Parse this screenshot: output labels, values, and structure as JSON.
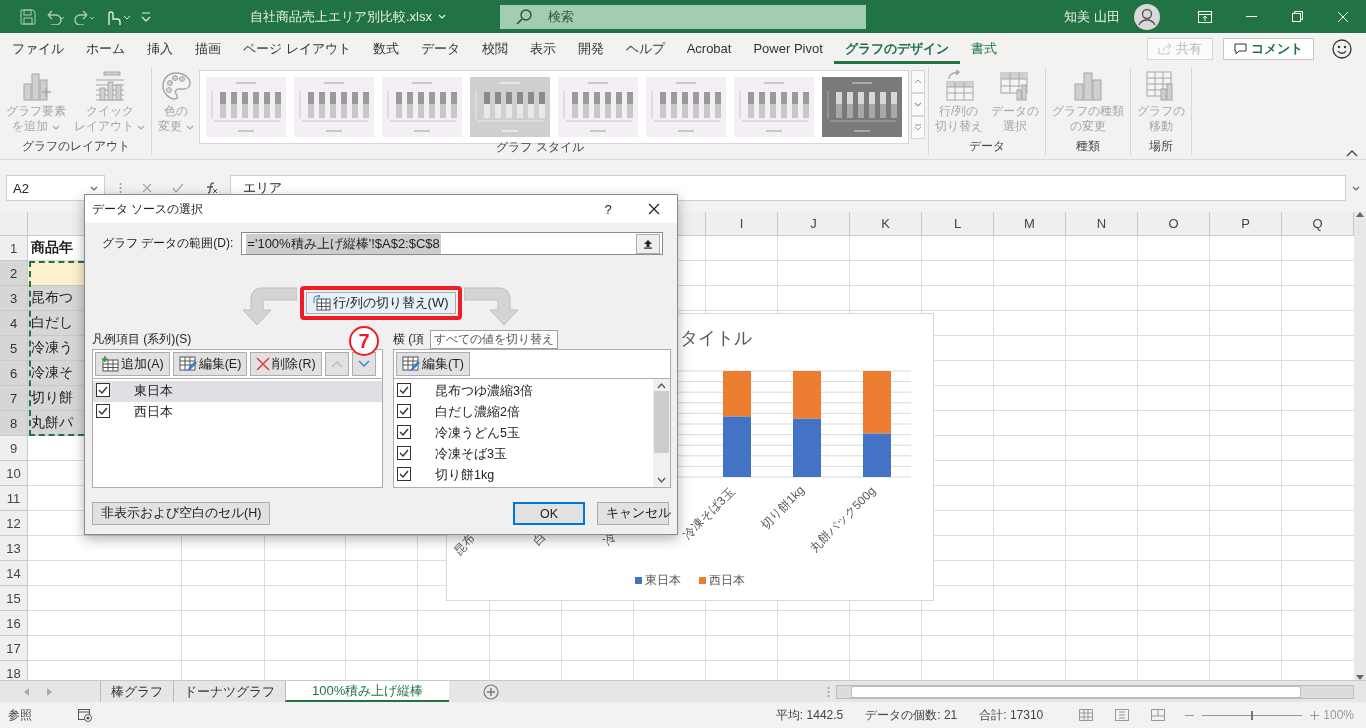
{
  "title_bar": {
    "file_name": "自社商品売上エリア別比較.xlsx",
    "search": {
      "placeholder": "検索"
    },
    "user_name": "知美 山田"
  },
  "menu_tabs": [
    {
      "label": "ファイル",
      "selected": false,
      "contextual": false
    },
    {
      "label": "ホーム",
      "selected": false,
      "contextual": false
    },
    {
      "label": "挿入",
      "selected": false,
      "contextual": false
    },
    {
      "label": "描画",
      "selected": false,
      "contextual": false
    },
    {
      "label": "ページ レイアウト",
      "selected": false,
      "contextual": false
    },
    {
      "label": "数式",
      "selected": false,
      "contextual": false
    },
    {
      "label": "データ",
      "selected": false,
      "contextual": false
    },
    {
      "label": "校閲",
      "selected": false,
      "contextual": false
    },
    {
      "label": "表示",
      "selected": false,
      "contextual": false
    },
    {
      "label": "開発",
      "selected": false,
      "contextual": false
    },
    {
      "label": "ヘルプ",
      "selected": false,
      "contextual": false
    },
    {
      "label": "Acrobat",
      "selected": false,
      "contextual": false
    },
    {
      "label": "Power Pivot",
      "selected": false,
      "contextual": false
    },
    {
      "label": "グラフのデザイン",
      "selected": true,
      "contextual": true
    },
    {
      "label": "書式",
      "selected": false,
      "contextual": true
    }
  ],
  "share_button": {
    "label": "共有",
    "disabled": true
  },
  "comment_button": {
    "label": "コメント"
  },
  "ribbon": {
    "groups": [
      {
        "label": "グラフのレイアウト",
        "buttons": [
          {
            "lines": [
              "グラフ要素",
              "を追加"
            ],
            "kind": "add-element",
            "dropdown": true,
            "disabled": true
          },
          {
            "lines": [
              "クイック",
              "レイアウト"
            ],
            "kind": "quick-layout",
            "dropdown": true,
            "disabled": true
          }
        ]
      },
      {
        "label": "グラフ スタイル",
        "buttons": [
          {
            "lines": [
              "色の",
              "変更"
            ],
            "kind": "palette",
            "dropdown": true,
            "disabled": true
          }
        ],
        "gallery": [
          {
            "kind": "light"
          },
          {
            "kind": "light"
          },
          {
            "kind": "light"
          },
          {
            "kind": "shaded"
          },
          {
            "kind": "light"
          },
          {
            "kind": "light"
          },
          {
            "kind": "light"
          },
          {
            "kind": "dark"
          }
        ]
      },
      {
        "label": "データ",
        "buttons": [
          {
            "lines": [
              "行/列の",
              "切り替え"
            ],
            "kind": "switch",
            "dropdown": false,
            "disabled": true
          },
          {
            "lines": [
              "データの",
              "選択"
            ],
            "kind": "select-data",
            "dropdown": false,
            "disabled": true
          }
        ]
      },
      {
        "label": "種類",
        "buttons": [
          {
            "lines": [
              "グラフの種類",
              "の変更"
            ],
            "kind": "change-type",
            "dropdown": false,
            "disabled": true
          }
        ]
      },
      {
        "label": "場所",
        "buttons": [
          {
            "lines": [
              "グラフの",
              "移動"
            ],
            "kind": "move-chart",
            "dropdown": false,
            "disabled": true
          }
        ]
      }
    ]
  },
  "formula_bar": {
    "name_box": "A2",
    "content": "エリア"
  },
  "sheet": {
    "column_headers": [
      "I",
      "J",
      "K",
      "L",
      "M",
      "N",
      "O",
      "P",
      "Q"
    ],
    "rows": [
      {
        "number": "1",
        "selected": false,
        "active": false,
        "cell": "商品年"
      },
      {
        "number": "2",
        "selected": true,
        "active": true
      },
      {
        "number": "3",
        "selected": true,
        "active": false,
        "cell": "昆布つ"
      },
      {
        "number": "4",
        "selected": true,
        "active": false,
        "cell": "白だし"
      },
      {
        "number": "5",
        "selected": true,
        "active": false,
        "cell": "冷凍う"
      },
      {
        "number": "6",
        "selected": true,
        "active": false,
        "cell": "冷凍そ"
      },
      {
        "number": "7",
        "selected": true,
        "active": false,
        "cell": "切り餅"
      },
      {
        "number": "8",
        "selected": true,
        "active": false,
        "cell": "丸餅パ"
      },
      {
        "number": "9",
        "selected": false,
        "active": false
      },
      {
        "number": "10",
        "selected": false,
        "active": false
      },
      {
        "number": "11",
        "selected": false,
        "active": false
      },
      {
        "number": "12",
        "selected": false,
        "active": false
      },
      {
        "number": "13",
        "selected": false,
        "active": false
      },
      {
        "number": "14",
        "selected": false,
        "active": false
      },
      {
        "number": "15",
        "selected": false,
        "active": false
      },
      {
        "number": "16",
        "selected": false,
        "active": false
      },
      {
        "number": "17",
        "selected": false,
        "active": false
      },
      {
        "number": "18",
        "selected": false,
        "active": false
      }
    ]
  },
  "chart": {
    "title": "タイトル",
    "categories": [
      "昆布",
      "白",
      "冷",
      "冷凍そば3玉",
      "切り餅1kg",
      "丸餅パック500g"
    ],
    "legend": [
      {
        "label": "東日本",
        "color": "#4472c4"
      },
      {
        "label": "西日本",
        "color": "#ed7d31"
      }
    ]
  },
  "dialog": {
    "title": "データ ソースの選択",
    "help": "?",
    "range_label": "グラフ データの範囲(D):",
    "range_value": "='100%積み上げ縦棒'!$A$2:$C$8",
    "switch_button": "行/列の切り替え(W)",
    "step_badge": "7",
    "tooltip": "すべての値を切り替え",
    "series_panel": {
      "label": "凡例項目 (系列)(S)",
      "buttons": [
        {
          "label": "追加(A)",
          "kind": "add",
          "disabled": false
        },
        {
          "label": "編集(E)",
          "kind": "edit",
          "disabled": false
        },
        {
          "label": "削除(R)",
          "kind": "delete",
          "disabled": false
        },
        {
          "kind": "up",
          "disabled": true
        },
        {
          "kind": "down",
          "disabled": false
        }
      ],
      "items": [
        {
          "label": "東日本",
          "checked": true,
          "selected": true
        },
        {
          "label": "西日本",
          "checked": true,
          "selected": false
        }
      ]
    },
    "category_panel": {
      "label": "横 (項",
      "buttons": [
        {
          "label": "編集(T)",
          "kind": "edit",
          "disabled": false
        }
      ],
      "items": [
        {
          "label": "昆布つゆ濃縮3倍",
          "checked": true,
          "selected": false
        },
        {
          "label": "白だし濃縮2倍",
          "checked": true,
          "selected": false
        },
        {
          "label": "冷凍うどん5玉",
          "checked": true,
          "selected": false
        },
        {
          "label": "冷凍そば3玉",
          "checked": true,
          "selected": false
        },
        {
          "label": "切り餅1kg",
          "checked": true,
          "selected": false
        }
      ]
    },
    "hidden_cells_button": "非表示および空白のセル(H)",
    "ok_button": "OK",
    "cancel_button": "キャンセル"
  },
  "sheet_tabs": [
    {
      "label": "棒グラフ",
      "selected": false
    },
    {
      "label": "ドーナツグラフ",
      "selected": false
    },
    {
      "label": "100%積み上げ縦棒",
      "selected": true
    }
  ],
  "status_bar": {
    "mode": "参照",
    "average": "平均: 1442.5",
    "count": "データの個数: 21",
    "sum": "合計: 17310",
    "zoom": "100%",
    "zoom_slider": {
      "level": 0.5
    }
  }
}
